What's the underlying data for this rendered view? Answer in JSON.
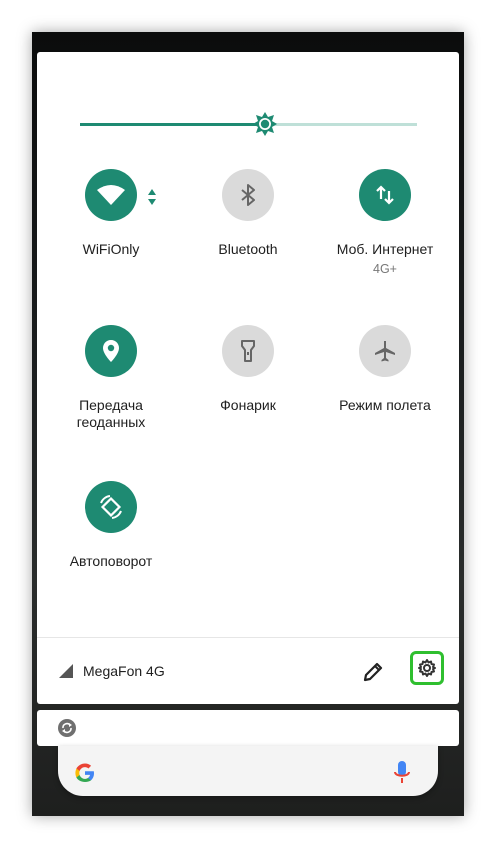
{
  "brightness": {
    "level": 0.55
  },
  "tiles": [
    {
      "label": "WiFiOnly",
      "sub": "",
      "state": "on",
      "icon": "wifi-icon"
    },
    {
      "label": "Bluetooth",
      "sub": "",
      "state": "off",
      "icon": "bluetooth-icon"
    },
    {
      "label": "Моб. Интернет",
      "sub": "4G+",
      "state": "on",
      "icon": "mobile-data-icon"
    },
    {
      "label": "Передача геоданных",
      "sub": "",
      "state": "on",
      "icon": "location-icon"
    },
    {
      "label": "Фонарик",
      "sub": "",
      "state": "off",
      "icon": "flashlight-icon"
    },
    {
      "label": "Режим полета",
      "sub": "",
      "state": "off",
      "icon": "airplane-icon"
    },
    {
      "label": "Автоповорот",
      "sub": "",
      "state": "on",
      "icon": "autorotate-icon"
    }
  ],
  "footer": {
    "carrier": "MegaFon 4G"
  },
  "colors": {
    "accent": "#1e8a72",
    "inactive": "#dadada",
    "highlight": "#2fbf2f"
  }
}
